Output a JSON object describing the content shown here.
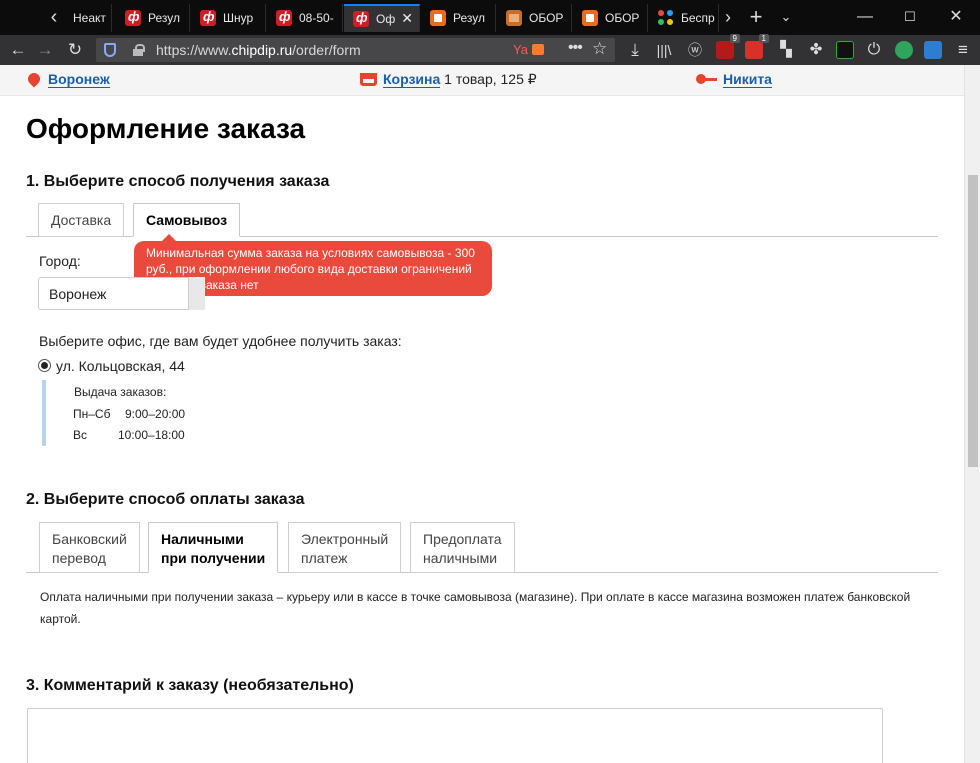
{
  "browser": {
    "tabs": [
      {
        "title": "Неакт",
        "icon": "none"
      },
      {
        "title": "Резул",
        "icon": "chipdip"
      },
      {
        "title": "Шнур",
        "icon": "chipdip"
      },
      {
        "title": "08-50-",
        "icon": "chipdip"
      },
      {
        "title": "Оф",
        "icon": "chipdip",
        "active": true
      },
      {
        "title": "Резул",
        "icon": "aliexpress"
      },
      {
        "title": "ОБОР",
        "icon": "box"
      },
      {
        "title": "ОБОР",
        "icon": "aliexpress"
      },
      {
        "title": "Беспр",
        "icon": "dots"
      }
    ],
    "url_prefix": "https://www.",
    "url_host": "chipdip.ru",
    "url_path": "/order/form",
    "url_badge": "Ya",
    "extensions": [
      {
        "name": "ublock-icon",
        "badge": "9",
        "color": "#b51a1a"
      },
      {
        "name": "notes-icon",
        "badge": "1",
        "color": "#d8312a"
      }
    ]
  },
  "site": {
    "city": "Воронеж",
    "cart_label": "Корзина",
    "cart_info": "1 товар, 125 ₽",
    "user": "Никита"
  },
  "page": {
    "title": "Оформление заказа",
    "section1": {
      "heading": "1. Выберите способ получения заказа",
      "tabs": [
        "Доставка",
        "Самовывоз"
      ],
      "active_tab": "Самовывоз",
      "tooltip": "Минимальная сумма заказа на условиях самовывоза - 300 руб., при оформлении любого вида доставки ограничений на сумму заказа нет",
      "city_label": "Город:",
      "city_value": "Воронеж",
      "office_prompt": "Выберите офис, где вам будет удобнее получить заказ:",
      "office": "ул. Кольцовская, 44",
      "hours_title": "Выдача заказов:",
      "hours": [
        {
          "days": "Пн–Сб",
          "time": "9:00–20:00"
        },
        {
          "days": "Вс",
          "time": "10:00–18:00"
        }
      ]
    },
    "section2": {
      "heading": "2. Выберите способ оплаты заказа",
      "tabs": [
        {
          "line1": "Банковский",
          "line2": "перевод"
        },
        {
          "line1": "Наличными",
          "line2": "при получении"
        },
        {
          "line1": "Электронный",
          "line2": "платеж"
        },
        {
          "line1": "Предоплата",
          "line2": "наличными"
        }
      ],
      "active_tab": "Наличными при получении",
      "description": "Оплата наличными при получении заказа – курьеру или в кассе в точке самовывоза (магазине). При оплате в кассе магазина возможен платеж банковской картой."
    },
    "section3": {
      "heading": "3. Комментарий к заказу (необязательно)",
      "comment_value": ""
    }
  },
  "colors": {
    "accent_red": "#e5452f",
    "link_blue": "#1a5fa8",
    "tooltip_bg": "#ea4a3c",
    "firefox_blue": "#0a84ff"
  }
}
